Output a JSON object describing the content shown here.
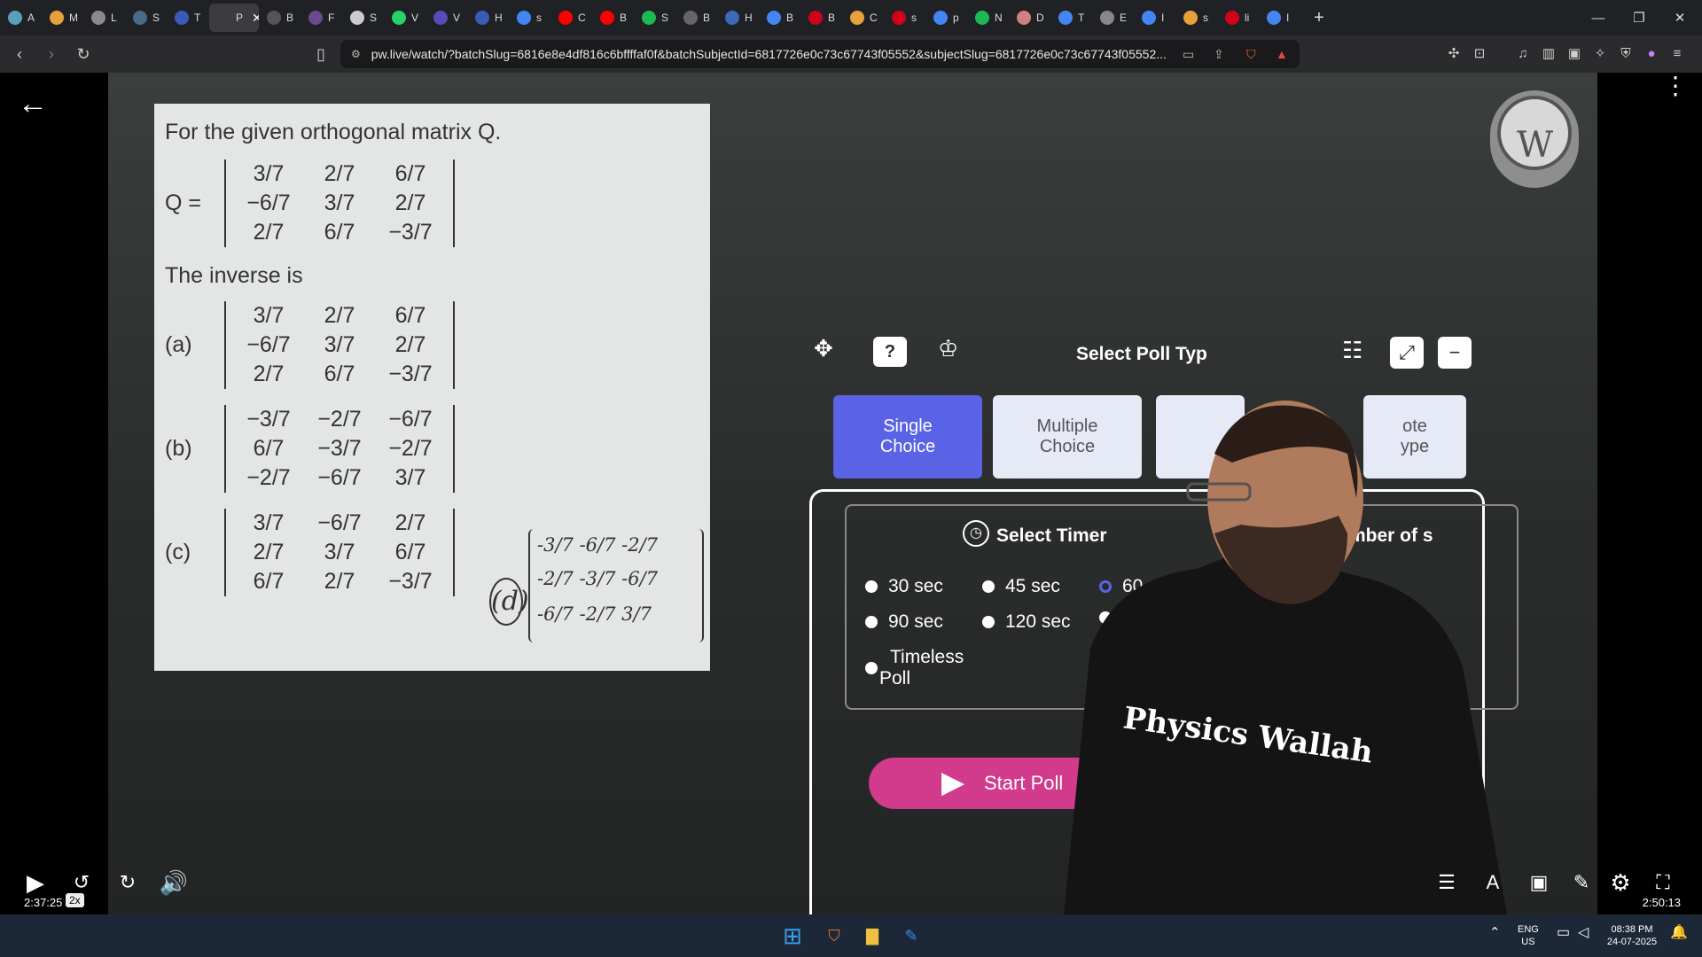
{
  "browser": {
    "tabs": [
      {
        "label": "A",
        "color": "#5aa0b8"
      },
      {
        "label": "M",
        "color": "#e6a23a"
      },
      {
        "label": "L",
        "color": "#8a8a8a"
      },
      {
        "label": "S",
        "color": "#4a6a8a"
      },
      {
        "label": "T",
        "color": "#3a5ab8"
      },
      {
        "label": "P",
        "color": "#3c3c3f",
        "active": true
      },
      {
        "label": "B",
        "color": "#555555"
      },
      {
        "label": "F",
        "color": "#6a4a8a"
      },
      {
        "label": "S",
        "color": "#cccccc"
      },
      {
        "label": "V",
        "color": "#25d366"
      },
      {
        "label": "V",
        "color": "#5a4ab8"
      },
      {
        "label": "H",
        "color": "#3a5ab8"
      },
      {
        "label": "s",
        "color": "#4285f4"
      },
      {
        "label": "C",
        "color": "#ff0000"
      },
      {
        "label": "B",
        "color": "#ff0000"
      },
      {
        "label": "S",
        "color": "#1db954"
      },
      {
        "label": "B",
        "color": "#666666"
      },
      {
        "label": "H",
        "color": "#3a6ab8"
      },
      {
        "label": "B",
        "color": "#4285f4"
      },
      {
        "label": "B",
        "color": "#d0021b"
      },
      {
        "label": "C",
        "color": "#e6a23a"
      },
      {
        "label": "s",
        "color": "#d0021b"
      },
      {
        "label": "p",
        "color": "#4285f4"
      },
      {
        "label": "N",
        "color": "#1db954"
      },
      {
        "label": "D",
        "color": "#d08080"
      },
      {
        "label": "T",
        "color": "#4285f4"
      },
      {
        "label": "E",
        "color": "#888888"
      },
      {
        "label": "I",
        "color": "#4285f4"
      },
      {
        "label": "s",
        "color": "#e6a23a"
      },
      {
        "label": "li",
        "color": "#d0021b"
      },
      {
        "label": "I",
        "color": "#4285f4"
      }
    ],
    "new_tab": "+",
    "url": "pw.live/watch/?batchSlug=6816e8e4df816c6bffffaf0f&batchSubjectId=6817726e0c73c67743f05552&subjectSlug=6817726e0c73c67743f05552..."
  },
  "question": {
    "title": "For the given orthogonal matrix Q.",
    "q_label": "Q =",
    "q_matrix": [
      "3/7",
      "2/7",
      "6/7",
      "−6/7",
      "3/7",
      "2/7",
      "2/7",
      "6/7",
      "−3/7"
    ],
    "inverse_text": "The inverse is",
    "options": [
      {
        "label": "(a)",
        "matrix": [
          "3/7",
          "2/7",
          "6/7",
          "−6/7",
          "3/7",
          "2/7",
          "2/7",
          "6/7",
          "−3/7"
        ]
      },
      {
        "label": "(b)",
        "matrix": [
          "−3/7",
          "−2/7",
          "−6/7",
          "6/7",
          "−3/7",
          "−2/7",
          "−2/7",
          "−6/7",
          "3/7"
        ]
      },
      {
        "label": "(c)",
        "matrix": [
          "3/7",
          "−6/7",
          "2/7",
          "2/7",
          "3/7",
          "6/7",
          "6/7",
          "2/7",
          "−3/7"
        ]
      }
    ],
    "handwritten_label": "(d)",
    "handwritten_rows": [
      "-3/7  -6/7  -2/7",
      "-2/7  -3/7  -6/7",
      "-6/7  -2/7   3/7"
    ]
  },
  "poll": {
    "title": "Select Poll Typ",
    "types": [
      "Single Choice",
      "Multiple Choice",
      "ote ype"
    ],
    "timer_title": "Select Timer",
    "right_label": "mber of s",
    "timers": [
      "30 sec",
      "45 sec",
      "60",
      "90 sec",
      "120 sec",
      "",
      "Timeless Poll"
    ],
    "start": "Start Poll"
  },
  "brand_text": "Physics Wallah",
  "player": {
    "time_now": "2:37:25",
    "speed": "2x",
    "time_total": "2:50:13",
    "progress": 0.937,
    "accent": "#6c73f1"
  },
  "taskbar": {
    "lang": "ENG",
    "region": "US",
    "clock": "08:38 PM",
    "date": "24-07-2025"
  }
}
